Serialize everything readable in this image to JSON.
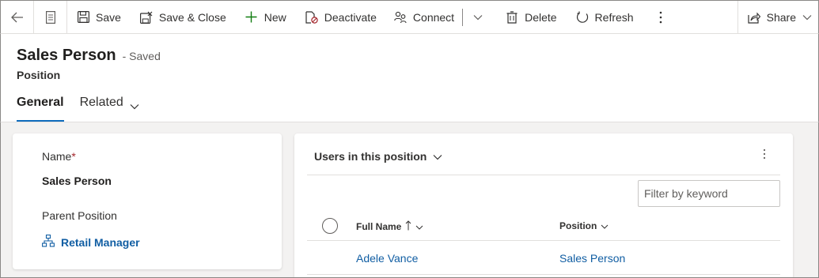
{
  "toolbar": {
    "icons": {
      "back": "back-arrow-icon",
      "form": "form-icon"
    },
    "save": "Save",
    "save_close": "Save & Close",
    "new": "New",
    "deactivate": "Deactivate",
    "connect": "Connect",
    "delete": "Delete",
    "refresh": "Refresh",
    "share": "Share"
  },
  "header": {
    "title": "Sales Person",
    "saved_status": "- Saved",
    "entity": "Position"
  },
  "tabs": [
    {
      "label": "General",
      "active": true
    },
    {
      "label": "Related",
      "active": false
    }
  ],
  "form": {
    "name_label": "Name",
    "name_required": "*",
    "name_value": "Sales Person",
    "parent_label": "Parent Position",
    "parent_value": "Retail Manager"
  },
  "subgrid": {
    "title": "Users in this position",
    "filter_placeholder": "Filter by keyword",
    "columns": [
      "Full Name",
      "Position"
    ],
    "rows": [
      {
        "full_name": "Adele Vance",
        "position": "Sales Person"
      }
    ]
  },
  "colors": {
    "accent": "#0f6cbd",
    "link": "#115ea3",
    "required": "#a4262c",
    "new_icon": "#107c10"
  }
}
